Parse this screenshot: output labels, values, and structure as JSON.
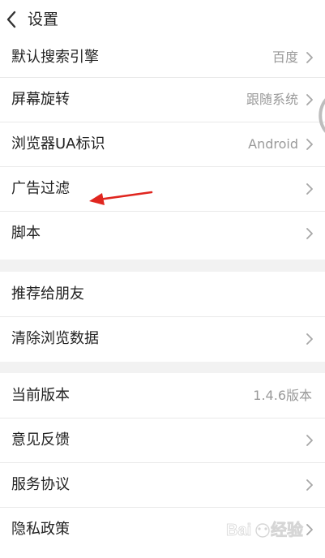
{
  "header": {
    "back_icon": "chevron-left-icon",
    "title": "设置"
  },
  "sections": [
    {
      "items": [
        {
          "label": "默认搜索引擎",
          "value": "百度",
          "has_chevron": true
        },
        {
          "label": "屏幕旋转",
          "value": "跟随系统",
          "has_chevron": true
        },
        {
          "label": "浏览器UA标识",
          "value": "Android",
          "has_chevron": true
        },
        {
          "label": "广告过滤",
          "value": "",
          "has_chevron": true
        },
        {
          "label": "脚本",
          "value": "",
          "has_chevron": true
        }
      ]
    },
    {
      "items": [
        {
          "label": "推荐给朋友",
          "value": "",
          "has_chevron": false
        },
        {
          "label": "清除浏览数据",
          "value": "",
          "has_chevron": true
        }
      ]
    },
    {
      "items": [
        {
          "label": "当前版本",
          "value": "1.4.6版本",
          "has_chevron": false
        },
        {
          "label": "意见反馈",
          "value": "",
          "has_chevron": true
        },
        {
          "label": "服务协议",
          "value": "",
          "has_chevron": true
        },
        {
          "label": "隐私政策",
          "value": "",
          "has_chevron": true
        }
      ]
    }
  ],
  "annotation": {
    "arrow_color": "#e0261f",
    "points_to": "广告过滤"
  },
  "watermark": {
    "text": "Baidu 经验"
  },
  "colors": {
    "page_background": "#f2f2f2",
    "card_background": "#ffffff",
    "divider": "#e9e9e9",
    "secondary_text": "#9a9a9a"
  }
}
